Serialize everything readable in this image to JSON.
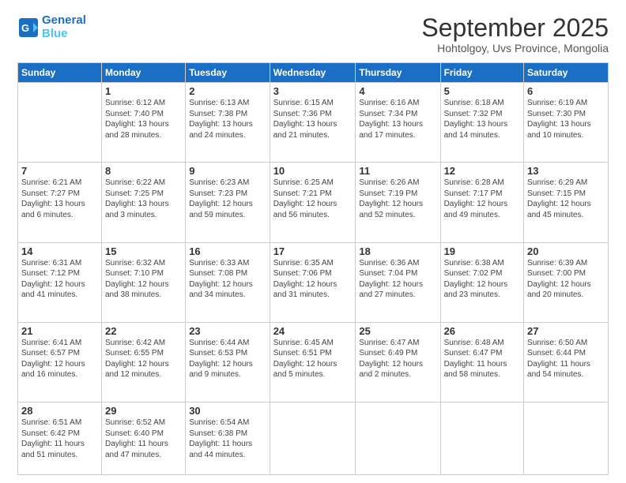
{
  "header": {
    "logo_line1": "General",
    "logo_line2": "Blue",
    "month": "September 2025",
    "location": "Hohtolgoy, Uvs Province, Mongolia"
  },
  "weekdays": [
    "Sunday",
    "Monday",
    "Tuesday",
    "Wednesday",
    "Thursday",
    "Friday",
    "Saturday"
  ],
  "weeks": [
    [
      {
        "day": "",
        "info": ""
      },
      {
        "day": "1",
        "info": "Sunrise: 6:12 AM\nSunset: 7:40 PM\nDaylight: 13 hours\nand 28 minutes."
      },
      {
        "day": "2",
        "info": "Sunrise: 6:13 AM\nSunset: 7:38 PM\nDaylight: 13 hours\nand 24 minutes."
      },
      {
        "day": "3",
        "info": "Sunrise: 6:15 AM\nSunset: 7:36 PM\nDaylight: 13 hours\nand 21 minutes."
      },
      {
        "day": "4",
        "info": "Sunrise: 6:16 AM\nSunset: 7:34 PM\nDaylight: 13 hours\nand 17 minutes."
      },
      {
        "day": "5",
        "info": "Sunrise: 6:18 AM\nSunset: 7:32 PM\nDaylight: 13 hours\nand 14 minutes."
      },
      {
        "day": "6",
        "info": "Sunrise: 6:19 AM\nSunset: 7:30 PM\nDaylight: 13 hours\nand 10 minutes."
      }
    ],
    [
      {
        "day": "7",
        "info": "Sunrise: 6:21 AM\nSunset: 7:27 PM\nDaylight: 13 hours\nand 6 minutes."
      },
      {
        "day": "8",
        "info": "Sunrise: 6:22 AM\nSunset: 7:25 PM\nDaylight: 13 hours\nand 3 minutes."
      },
      {
        "day": "9",
        "info": "Sunrise: 6:23 AM\nSunset: 7:23 PM\nDaylight: 12 hours\nand 59 minutes."
      },
      {
        "day": "10",
        "info": "Sunrise: 6:25 AM\nSunset: 7:21 PM\nDaylight: 12 hours\nand 56 minutes."
      },
      {
        "day": "11",
        "info": "Sunrise: 6:26 AM\nSunset: 7:19 PM\nDaylight: 12 hours\nand 52 minutes."
      },
      {
        "day": "12",
        "info": "Sunrise: 6:28 AM\nSunset: 7:17 PM\nDaylight: 12 hours\nand 49 minutes."
      },
      {
        "day": "13",
        "info": "Sunrise: 6:29 AM\nSunset: 7:15 PM\nDaylight: 12 hours\nand 45 minutes."
      }
    ],
    [
      {
        "day": "14",
        "info": "Sunrise: 6:31 AM\nSunset: 7:12 PM\nDaylight: 12 hours\nand 41 minutes."
      },
      {
        "day": "15",
        "info": "Sunrise: 6:32 AM\nSunset: 7:10 PM\nDaylight: 12 hours\nand 38 minutes."
      },
      {
        "day": "16",
        "info": "Sunrise: 6:33 AM\nSunset: 7:08 PM\nDaylight: 12 hours\nand 34 minutes."
      },
      {
        "day": "17",
        "info": "Sunrise: 6:35 AM\nSunset: 7:06 PM\nDaylight: 12 hours\nand 31 minutes."
      },
      {
        "day": "18",
        "info": "Sunrise: 6:36 AM\nSunset: 7:04 PM\nDaylight: 12 hours\nand 27 minutes."
      },
      {
        "day": "19",
        "info": "Sunrise: 6:38 AM\nSunset: 7:02 PM\nDaylight: 12 hours\nand 23 minutes."
      },
      {
        "day": "20",
        "info": "Sunrise: 6:39 AM\nSunset: 7:00 PM\nDaylight: 12 hours\nand 20 minutes."
      }
    ],
    [
      {
        "day": "21",
        "info": "Sunrise: 6:41 AM\nSunset: 6:57 PM\nDaylight: 12 hours\nand 16 minutes."
      },
      {
        "day": "22",
        "info": "Sunrise: 6:42 AM\nSunset: 6:55 PM\nDaylight: 12 hours\nand 12 minutes."
      },
      {
        "day": "23",
        "info": "Sunrise: 6:44 AM\nSunset: 6:53 PM\nDaylight: 12 hours\nand 9 minutes."
      },
      {
        "day": "24",
        "info": "Sunrise: 6:45 AM\nSunset: 6:51 PM\nDaylight: 12 hours\nand 5 minutes."
      },
      {
        "day": "25",
        "info": "Sunrise: 6:47 AM\nSunset: 6:49 PM\nDaylight: 12 hours\nand 2 minutes."
      },
      {
        "day": "26",
        "info": "Sunrise: 6:48 AM\nSunset: 6:47 PM\nDaylight: 11 hours\nand 58 minutes."
      },
      {
        "day": "27",
        "info": "Sunrise: 6:50 AM\nSunset: 6:44 PM\nDaylight: 11 hours\nand 54 minutes."
      }
    ],
    [
      {
        "day": "28",
        "info": "Sunrise: 6:51 AM\nSunset: 6:42 PM\nDaylight: 11 hours\nand 51 minutes."
      },
      {
        "day": "29",
        "info": "Sunrise: 6:52 AM\nSunset: 6:40 PM\nDaylight: 11 hours\nand 47 minutes."
      },
      {
        "day": "30",
        "info": "Sunrise: 6:54 AM\nSunset: 6:38 PM\nDaylight: 11 hours\nand 44 minutes."
      },
      {
        "day": "",
        "info": ""
      },
      {
        "day": "",
        "info": ""
      },
      {
        "day": "",
        "info": ""
      },
      {
        "day": "",
        "info": ""
      }
    ]
  ]
}
